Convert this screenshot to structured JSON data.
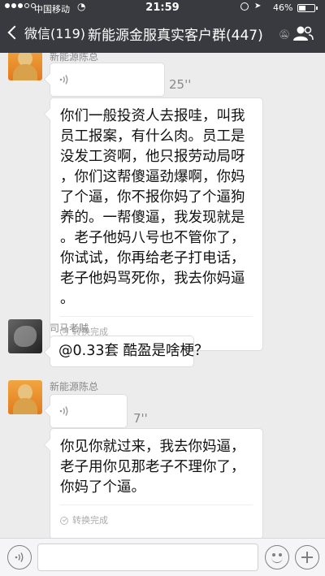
{
  "status_bar": {
    "carrier": "中国移动",
    "time": "21:59",
    "battery_percent": "46%",
    "battery_level": 0.46
  },
  "nav": {
    "back_label": "微信(119)",
    "title": "新能源金服真实客户群(447)"
  },
  "messages": [
    {
      "sender": "新能源陈总",
      "type": "voice",
      "duration": "25''"
    },
    {
      "sender": "新能源陈总",
      "type": "transcription",
      "lines": [
        "你们一般投资人去报哇，叫我",
        "员工报案，有什么肉。员工是",
        "没发工资啊，他只报劳动局呀",
        "，你们这帮傻逼劲爆啊，你妈",
        "了个逼，你不报你妈了个逼狗",
        "养的。一帮傻逼，我发现就是",
        "。老子他妈八号也不管你了，",
        "你试试，你再给老子打电话，",
        "老子他妈骂死你，我去你妈逼",
        "。"
      ],
      "status": "转换完成"
    },
    {
      "sender": "司马老贼",
      "type": "text",
      "text": "@0.33套 酷盈是啥梗？"
    },
    {
      "sender": "新能源陈总",
      "type": "voice",
      "duration": "7''"
    },
    {
      "sender": "新能源陈总",
      "type": "transcription",
      "lines": [
        "你见你就过来，我去你妈逼，",
        "老子用你见那老子不理你了，",
        "你妈了个逼。"
      ],
      "status": "转换完成"
    }
  ],
  "colors": {
    "nav_bg": "#393a3f",
    "chat_bg": "#ececec"
  }
}
